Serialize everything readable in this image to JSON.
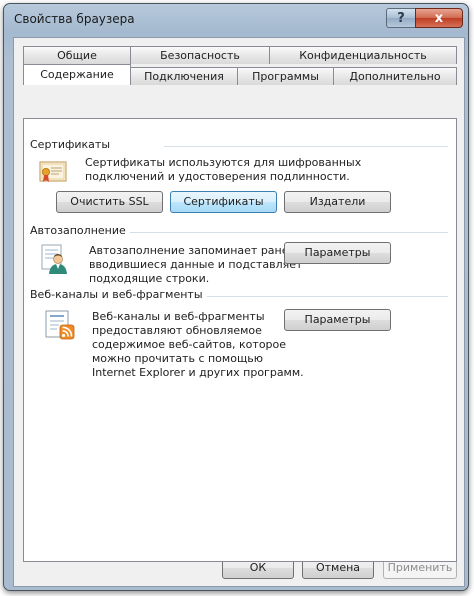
{
  "window": {
    "title": "Свойства браузера",
    "help_glyph": "?",
    "close_glyph": "x"
  },
  "tabs": {
    "row1": [
      "Общие",
      "Безопасность",
      "Конфиденциальность"
    ],
    "row2": [
      "Содержание",
      "Подключения",
      "Программы",
      "Дополнительно"
    ],
    "selected": "Содержание"
  },
  "certificates": {
    "label": "Сертификаты",
    "description_line1": "Сертификаты используются для шифрованных",
    "description_line2": "подключений и удостоверения подлинности.",
    "clear_ssl_label": "Очистить SSL",
    "certificates_label": "Сертификаты",
    "publishers_label": "Издатели"
  },
  "autocomplete": {
    "label": "Автозаполнение",
    "description_line1": "Автозаполнение запоминает ранее",
    "description_line2": "вводившиеся данные и подставляет",
    "description_line3": "подходящие строки.",
    "settings_label": "Параметры"
  },
  "feeds": {
    "label": "Веб-каналы и веб-фрагменты",
    "description_line1": "Веб-каналы и веб-фрагменты",
    "description_line2": "предоставляют обновляемое",
    "description_line3": "содержимое веб-сайтов, которое",
    "description_line4": "можно прочитать с помощью",
    "description_line5": "Internet Explorer и других программ.",
    "settings_label": "Параметры"
  },
  "footer": {
    "ok_label": "ОК",
    "cancel_label": "Отмена",
    "apply_label": "Применить"
  },
  "icons": {
    "certificate": "certificate-icon",
    "autocomplete": "autocomplete-user-icon",
    "feeds": "feeds-rss-icon"
  },
  "colors": {
    "selected_button_border": "#3c7fb1",
    "close_button": "#c84a30",
    "rss_orange": "#f08a24"
  }
}
